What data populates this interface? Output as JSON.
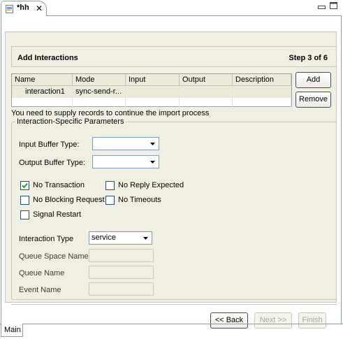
{
  "editor_tab": {
    "title": "*hh",
    "close_glyph": "✕",
    "icon": "document-icon"
  },
  "window_controls": {
    "minimize_icon": "minimize-icon",
    "maximize_icon": "maximize-icon"
  },
  "header": {
    "title": "Add Interactions",
    "step": "Step 3 of 6"
  },
  "table": {
    "columns": [
      "Name",
      "Mode",
      "Input",
      "Output",
      "Description"
    ],
    "rows": [
      {
        "name": "interaction1",
        "mode": "sync-send-r...",
        "input": "",
        "output": "",
        "description": ""
      }
    ]
  },
  "buttons": {
    "add": "Add",
    "remove": "Remove",
    "back": "<< Back",
    "next": "Next >>",
    "finish": "Finish"
  },
  "warning": "You need to supply records to continue the import process",
  "group": {
    "title": "Interaction-Specific Parameters",
    "input_buffer_label": "Input Buffer Type:",
    "input_buffer_value": "",
    "output_buffer_label": "Output Buffer Type:",
    "output_buffer_value": "",
    "checkboxes": {
      "no_transaction": {
        "label": "No Transaction",
        "checked": true
      },
      "no_reply_expected": {
        "label": "No Reply Expected",
        "checked": false
      },
      "no_blocking_request": {
        "label": "No Blocking Request",
        "checked": false
      },
      "no_timeouts": {
        "label": "No Timeouts",
        "checked": false
      },
      "signal_restart": {
        "label": "Signal Restart",
        "checked": false
      }
    },
    "interaction_type_label": "Interaction Type",
    "interaction_type_value": "service",
    "queue_space_label": "Queue Space Name",
    "queue_name_label": "Queue Name",
    "event_name_label": "Event Name"
  },
  "bottom_tab": {
    "label": "Main"
  },
  "colors": {
    "accent_border": "#3c5077",
    "panel_bg": "#f1efe2",
    "tab_border": "#8c9ab8"
  }
}
